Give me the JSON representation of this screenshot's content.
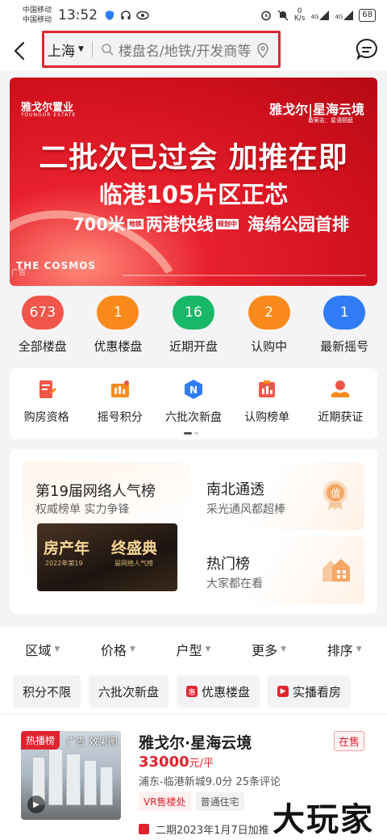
{
  "status_bar": {
    "carrier1": "中国移动",
    "carrier2": "中国移动",
    "time": "13:52",
    "speed_value": "0",
    "speed_unit": "K/s",
    "net1": "4G",
    "net2": "4G",
    "battery": "68"
  },
  "header": {
    "city": "上海",
    "search_placeholder": "楼盘名/地铁/开发商等"
  },
  "banner": {
    "brand_left": "雅戈尔置业",
    "brand_left_en": "YOUNGOR ESTATE",
    "brand_right": "雅戈尔|星海云境",
    "brand_right_sub": "备案名：星语颐庭",
    "headline": "二批次已过会 加推在即",
    "line2": "临港105片区正芯",
    "line3_a": "700米",
    "line3_tag": "地铁",
    "line3_b": "两港快线",
    "line3_tag2": "规划中",
    "line3_c": "海绵公园首排",
    "project_en": "THE COSMOS",
    "ad_mark": "广告"
  },
  "stats": [
    {
      "value": "673",
      "label": "全部楼盘",
      "color": "#f0564a"
    },
    {
      "value": "1",
      "label": "优惠楼盘",
      "color": "#fb8a1c"
    },
    {
      "value": "16",
      "label": "近期开盘",
      "color": "#19b869"
    },
    {
      "value": "2",
      "label": "认购中",
      "color": "#fb8a1c"
    },
    {
      "value": "1",
      "label": "最新摇号",
      "color": "#2f7cf6"
    }
  ],
  "menu": [
    {
      "label": "购房资格",
      "icon": "qualification-icon"
    },
    {
      "label": "摇号积分",
      "icon": "lottery-points-icon"
    },
    {
      "label": "六批次新盘",
      "icon": "new-batch-icon"
    },
    {
      "label": "认购榜单",
      "icon": "subscription-rank-icon"
    },
    {
      "label": "近期获证",
      "icon": "recent-permit-icon"
    }
  ],
  "ranks": {
    "main_title": "第19届网络人气榜",
    "main_sub": "权威榜单 实力争锋",
    "main_img_a": "房产年",
    "main_img_b": "终盛典",
    "main_img_c": "2022年第19",
    "main_img_d": "届网络人气榜",
    "side1_title": "南北通透",
    "side1_sub": "采光通风都超棒",
    "side1_badge": "值",
    "side2_title": "热门榜",
    "side2_sub": "大家都在看"
  },
  "filters": [
    "区域",
    "价格",
    "户型",
    "更多",
    "排序"
  ],
  "chips": [
    {
      "label": "积分不限"
    },
    {
      "label": "六批次新盘"
    },
    {
      "label": "优惠楼盘",
      "icon": "惠"
    },
    {
      "label": "实播看房"
    }
  ],
  "listing": {
    "hot_tag": "热播榜",
    "ad_tags": "广告  效果图",
    "title": "雅戈尔·星海云境",
    "status": "在售",
    "price": "33000",
    "price_unit": "元/平",
    "meta": "浦东-临港新城9.0分 25条评论",
    "tag1": "VR售楼处",
    "tag2": "普通住宅",
    "open_info": "二期2023年1月7日加推"
  },
  "watermark": "大玩家"
}
